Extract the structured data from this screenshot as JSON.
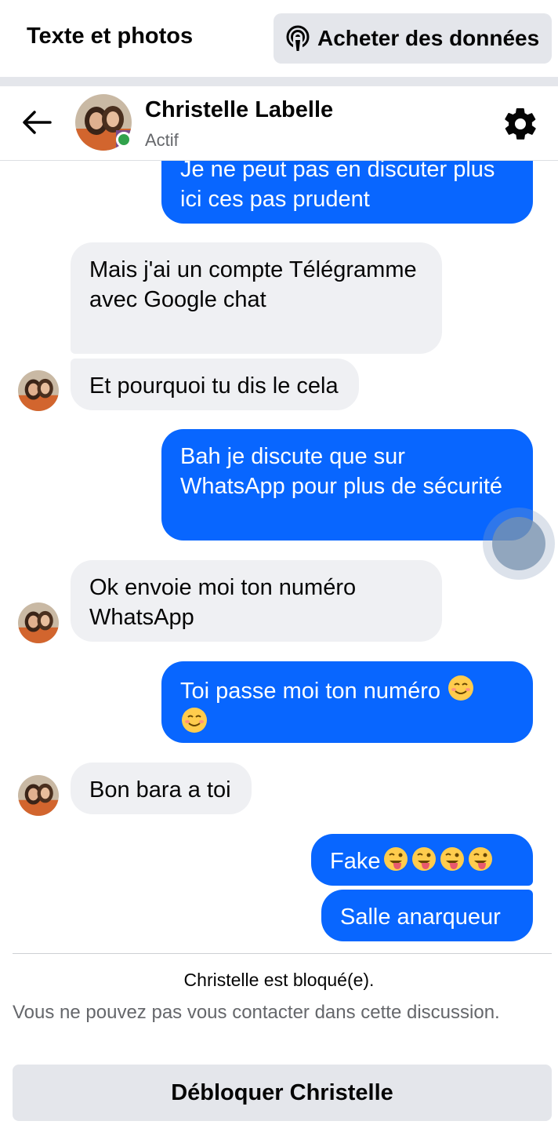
{
  "topbar": {
    "title": "Texte et photos",
    "buy_data_label": "Acheter des données",
    "buy_data_icon": "podcast-icon"
  },
  "header": {
    "contact_name": "Christelle Labelle",
    "status": "Actif",
    "online_color": "#31a24c",
    "back_icon": "arrow-left-icon",
    "settings_icon": "gear-icon"
  },
  "messages": [
    {
      "from": "me",
      "text": "Je ne peut pas en discuter plus ici ces pas prudent"
    },
    {
      "from": "them",
      "text": "Mais j'ai un compte Télégramme avec Google chat"
    },
    {
      "from": "them",
      "text": "Et pourquoi tu dis le cela"
    },
    {
      "from": "me",
      "text": "Bah je discute que sur WhatsApp pour plus de sécurité"
    },
    {
      "from": "them",
      "text": "Ok envoie moi ton numéro WhatsApp"
    },
    {
      "from": "me",
      "text": "Toi passe moi ton numéro",
      "emojis": "☺☺"
    },
    {
      "from": "them",
      "text": "Bon bara a toi"
    },
    {
      "from": "me",
      "text": "Fake",
      "emojis": "😜😜😜😜"
    },
    {
      "from": "me",
      "text": "Salle anarqueur"
    }
  ],
  "footer": {
    "blocked_text": "Christelle est bloqué(e).",
    "info_text": "Vous ne pouvez pas vous contacter dans cette discussion.",
    "unblock_label": "Débloquer Christelle"
  },
  "colors": {
    "outgoing_bubble": "#0866ff",
    "incoming_bubble": "#eff0f3",
    "button_gray": "#e4e6eb"
  }
}
